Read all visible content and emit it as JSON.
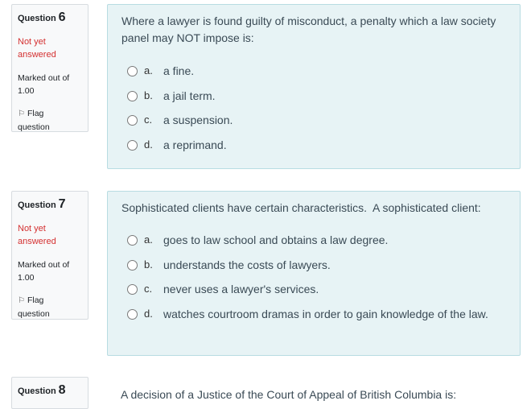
{
  "questions": [
    {
      "label": "Question",
      "number": "6",
      "state": "Not yet answered",
      "grade": "Marked out of 1.00",
      "flag_label": "Flag question",
      "text": "Where a lawyer is found guilty of misconduct, a penalty which a law society panel may NOT impose is:",
      "answers": [
        {
          "letter": "a.",
          "text": "a fine."
        },
        {
          "letter": "b.",
          "text": "a jail term."
        },
        {
          "letter": "c.",
          "text": "a suspension."
        },
        {
          "letter": "d.",
          "text": "a reprimand."
        }
      ]
    },
    {
      "label": "Question",
      "number": "7",
      "state": "Not yet answered",
      "grade": "Marked out of 1.00",
      "flag_label": "Flag question",
      "text": "Sophisticated clients have certain characteristics.  A sophisticated client:",
      "answers": [
        {
          "letter": "a.",
          "text": "goes to law school and obtains a law degree."
        },
        {
          "letter": "b.",
          "text": "understands the costs of lawyers."
        },
        {
          "letter": "c.",
          "text": "never uses a lawyer's services."
        },
        {
          "letter": "d.",
          "text": "watches courtroom dramas in order to gain knowledge of the law."
        }
      ]
    },
    {
      "label": "Question",
      "number": "8",
      "text": "A decision of a Justice of the Court of Appeal of British Columbia is:"
    }
  ],
  "icons": {
    "flag": "flag-icon",
    "radio": "radio-button"
  }
}
